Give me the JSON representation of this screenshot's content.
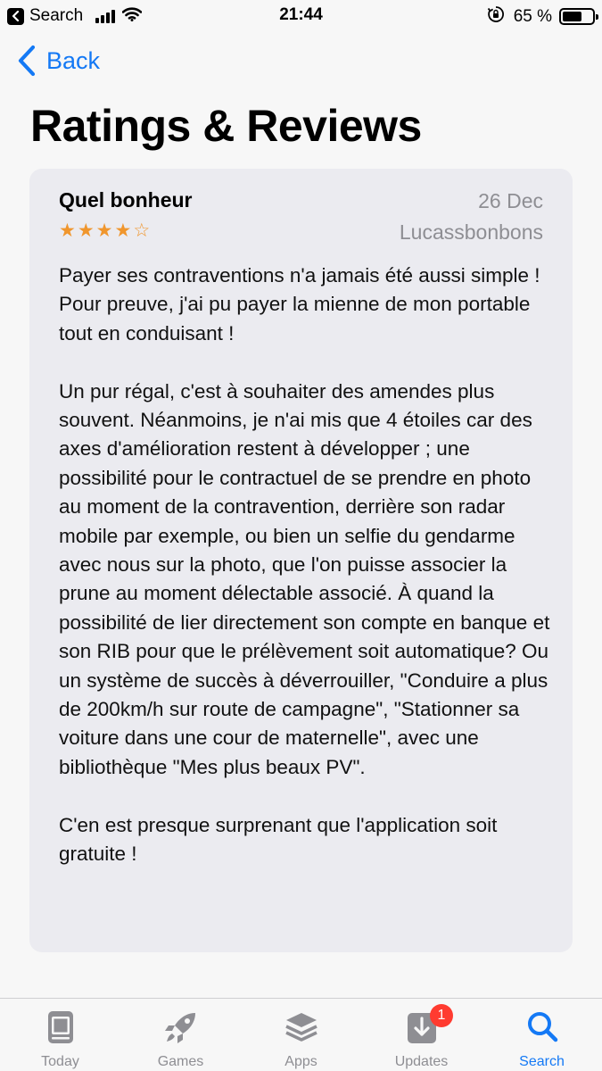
{
  "status_bar": {
    "back_app_label": "Search",
    "time": "21:44",
    "battery_percent": "65 %",
    "battery_level": 0.65
  },
  "nav": {
    "back_label": "Back",
    "page_title": "Ratings & Reviews"
  },
  "review": {
    "title": "Quel bonheur",
    "date": "26 Dec",
    "author": "Lucassbonbons",
    "rating": 4,
    "max_rating": 5,
    "stars": [
      "★",
      "★",
      "★",
      "★",
      "☆"
    ],
    "paragraphs": [
      "Payer ses contraventions n'a jamais été aussi simple ! Pour preuve, j'ai pu payer la mienne de mon portable tout en conduisant !",
      "Un pur régal, c'est à souhaiter des amendes plus souvent. Néanmoins, je n'ai mis que 4 étoiles car des axes d'amélioration restent à développer ; une possibilité pour le contractuel de se prendre en photo au moment de la contravention, derrière son radar mobile par exemple, ou bien un selfie du gendarme avec nous sur la photo, que l'on puisse associer la prune au moment délectable associé. À quand la possibilité de lier directement son compte en banque et son RIB pour que le prélèvement soit automatique? Ou un système de succès à déverrouiller, \"Conduire a plus de 200km/h sur route de campagne\", \"Stationner sa voiture dans une cour de maternelle\", avec une bibliothèque \"Mes plus beaux PV\".",
      "C'en est presque surprenant que l'application soit gratuite !"
    ]
  },
  "tab_bar": {
    "tabs": [
      {
        "label": "Today",
        "icon": "today-icon"
      },
      {
        "label": "Games",
        "icon": "rocket-icon"
      },
      {
        "label": "Apps",
        "icon": "layers-icon"
      },
      {
        "label": "Updates",
        "icon": "download-icon",
        "badge": "1"
      },
      {
        "label": "Search",
        "icon": "search-icon",
        "active": true
      }
    ]
  },
  "colors": {
    "accent": "#1479f5",
    "star": "#f0962d",
    "badge": "#ff3b30",
    "card_bg": "#ebebf0",
    "secondary_text": "#8e8e93"
  }
}
